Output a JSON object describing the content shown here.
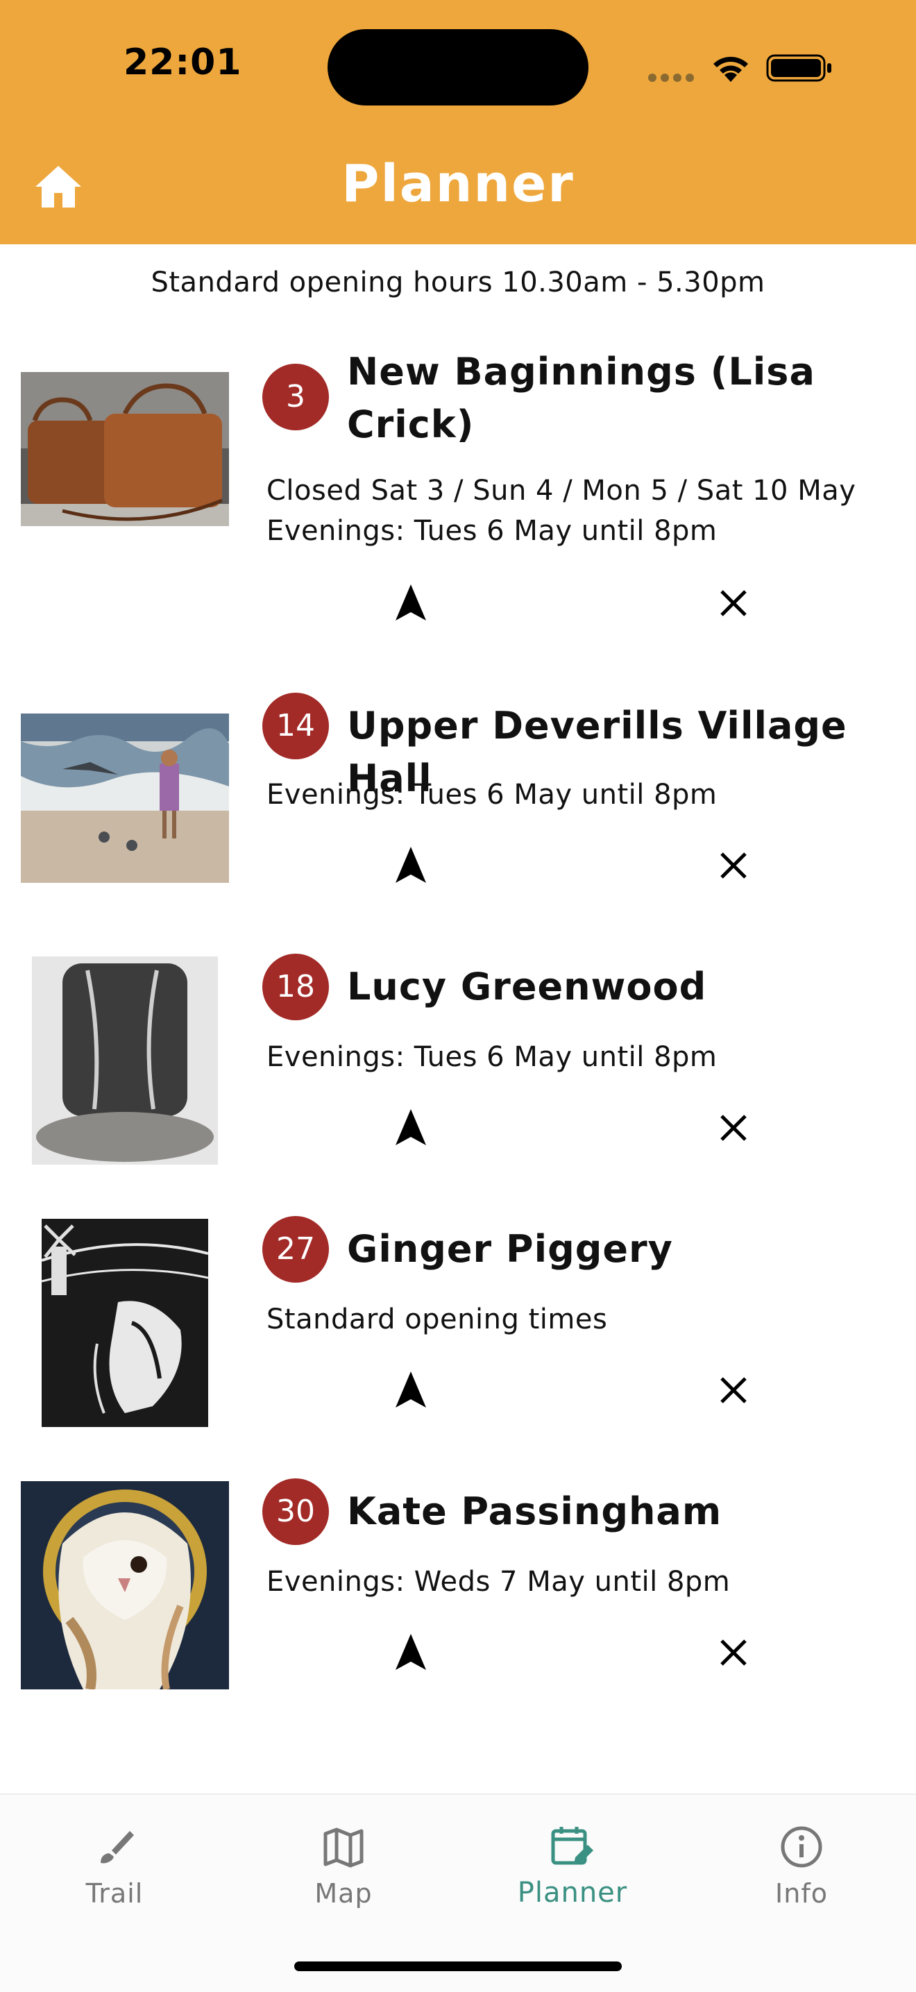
{
  "status_bar": {
    "time": "22:01"
  },
  "header": {
    "title": "Planner",
    "home_icon": "home-icon",
    "background": "#EEA73C"
  },
  "subtitle": "Standard opening hours 10.30am - 5.30pm",
  "items": [
    {
      "number": "3",
      "name": "New Baginnings (Lisa Crick)",
      "note": "Closed Sat 3 / Sun 4 / Mon 5 / Sat 10 May\nEvenings: Tues 6 May until 8pm",
      "image": "leather-bags-photo"
    },
    {
      "number": "14",
      "name": "Upper Deverills Village Hall",
      "note": "Evenings: Tues 6 May until 8pm",
      "image": "beach-painting"
    },
    {
      "number": "18",
      "name": "Lucy Greenwood",
      "note": "Evenings: Tues 6 May until 8pm",
      "image": "silver-jewellery-photo"
    },
    {
      "number": "27",
      "name": "Ginger Piggery",
      "note": "Standard opening times",
      "image": "horse-print"
    },
    {
      "number": "30",
      "name": "Kate Passingham",
      "note": "Evenings: Weds 7 May until 8pm",
      "image": "barn-owl-painting"
    }
  ],
  "badge_color": "#A22A27",
  "tabs": [
    {
      "label": "Trail",
      "icon": "brush-icon",
      "active": false
    },
    {
      "label": "Map",
      "icon": "map-icon",
      "active": false
    },
    {
      "label": "Planner",
      "icon": "calendar-edit-icon",
      "active": true
    },
    {
      "label": "Info",
      "icon": "info-icon",
      "active": false
    }
  ],
  "active_tab_color": "#3A9082"
}
